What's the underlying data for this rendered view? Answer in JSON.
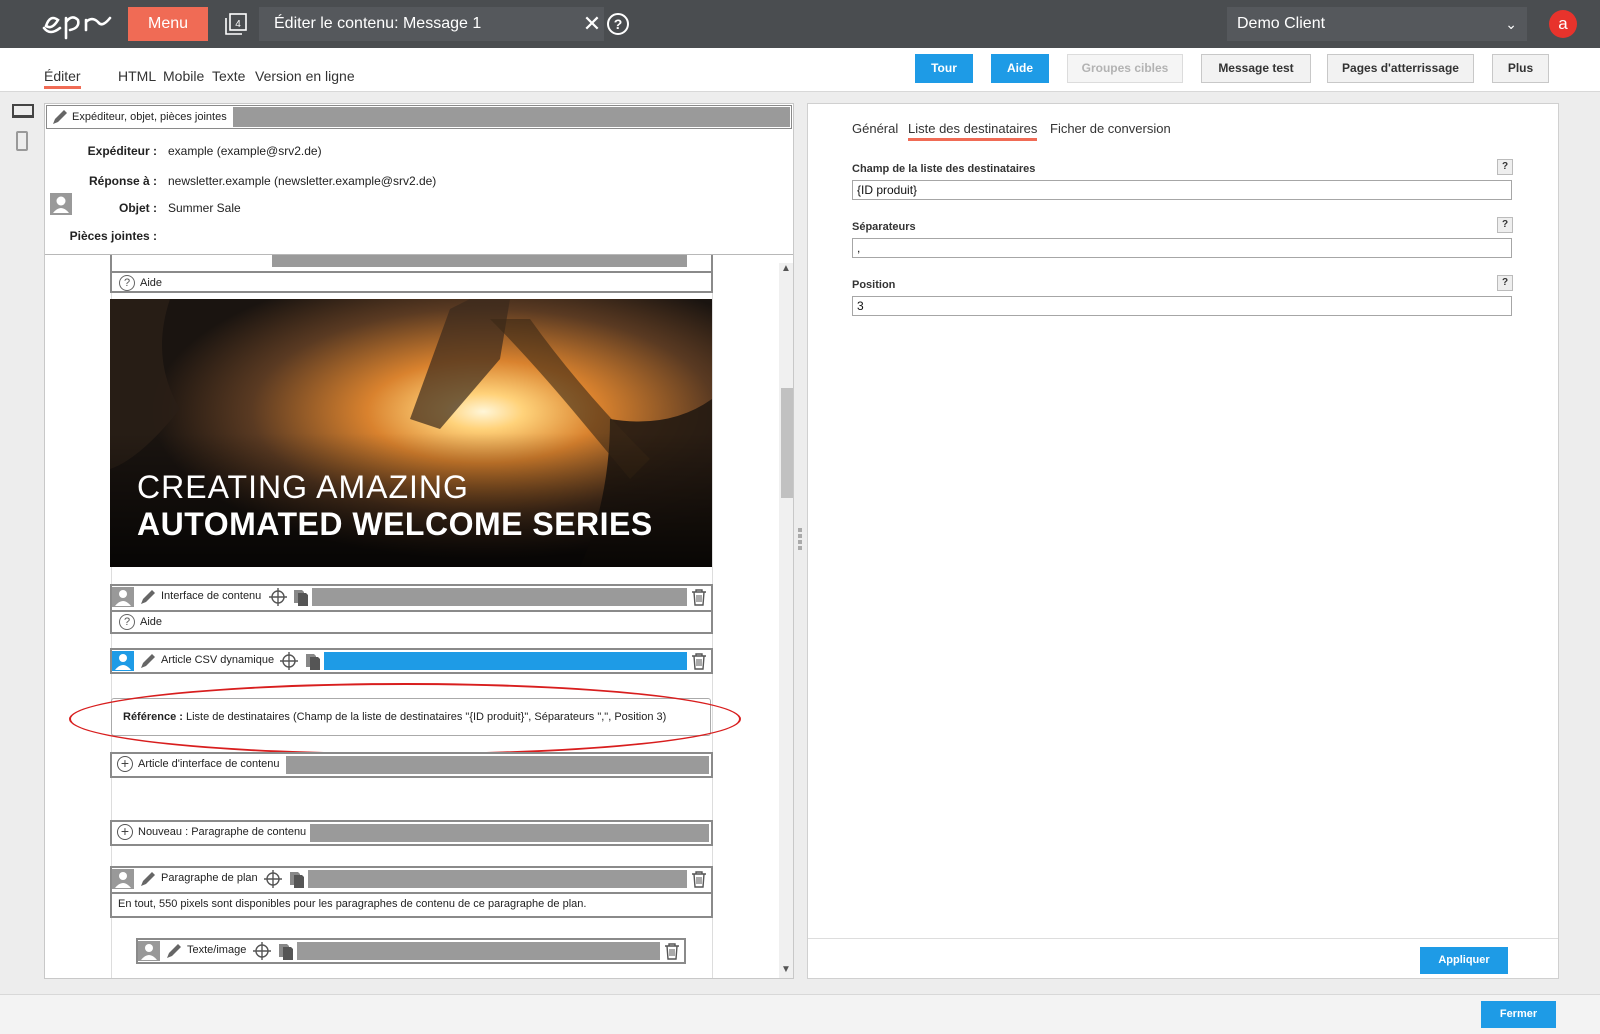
{
  "topbar": {
    "menu_label": "Menu",
    "count": "4",
    "title": "Éditer le contenu: Message 1",
    "client": "Demo Client",
    "avatar_letter": "a"
  },
  "toolbar": {
    "tabs": [
      "Éditer",
      "HTML",
      "Mobile",
      "Texte",
      "Version en ligne"
    ],
    "buttons": {
      "tour": "Tour",
      "aide": "Aide",
      "groupes": "Groupes cibles",
      "message_test": "Message test",
      "pages": "Pages d'atterrissage",
      "plus": "Plus"
    }
  },
  "sender": {
    "header": "Expéditeur, objet, pièces jointes",
    "expediteur_label": "Expéditeur :",
    "expediteur_value": "example (example@srv2.de)",
    "reponse_label": "Réponse à :",
    "reponse_value": "newsletter.example (newsletter.example@srv2.de)",
    "objet_label": "Objet :",
    "objet_value": "Summer Sale",
    "pj_label": "Pièces jointes :"
  },
  "canvas": {
    "aide_top": "Aide",
    "hero_line1": "CREATING AMAZING",
    "hero_line2": "AUTOMATED WELCOME SERIES",
    "interface_contenu": "Interface de contenu",
    "aide": "Aide",
    "article_csv": "Article CSV dynamique",
    "reference_label": "Référence :",
    "reference_text": " Liste de destinataires (Champ de la liste de destinataires \"{ID produit}\", Séparateurs \",\", Position 3)",
    "article_interface": "Article d'interface de contenu",
    "nouveau_paragraphe": "Nouveau : Paragraphe de contenu",
    "paragraphe_plan": "Paragraphe de plan",
    "plan_desc": "En tout, 550 pixels sont disponibles pour les paragraphes de contenu de ce paragraphe de plan.",
    "texte_image": "Texte/image"
  },
  "right": {
    "tabs": [
      "Général",
      "Liste des destinataires",
      "Ficher de conversion"
    ],
    "fields": [
      {
        "label": "Champ de la liste des destinataires",
        "value": "{ID produit}"
      },
      {
        "label": "Séparateurs",
        "value": ","
      },
      {
        "label": "Position",
        "value": "3"
      }
    ],
    "help": "?",
    "apply": "Appliquer"
  },
  "footer": {
    "close": "Fermer"
  },
  "colors": {
    "accent_red": "#f06b55",
    "primary_blue": "#1e9be6",
    "topbar": "#4a4d50"
  }
}
